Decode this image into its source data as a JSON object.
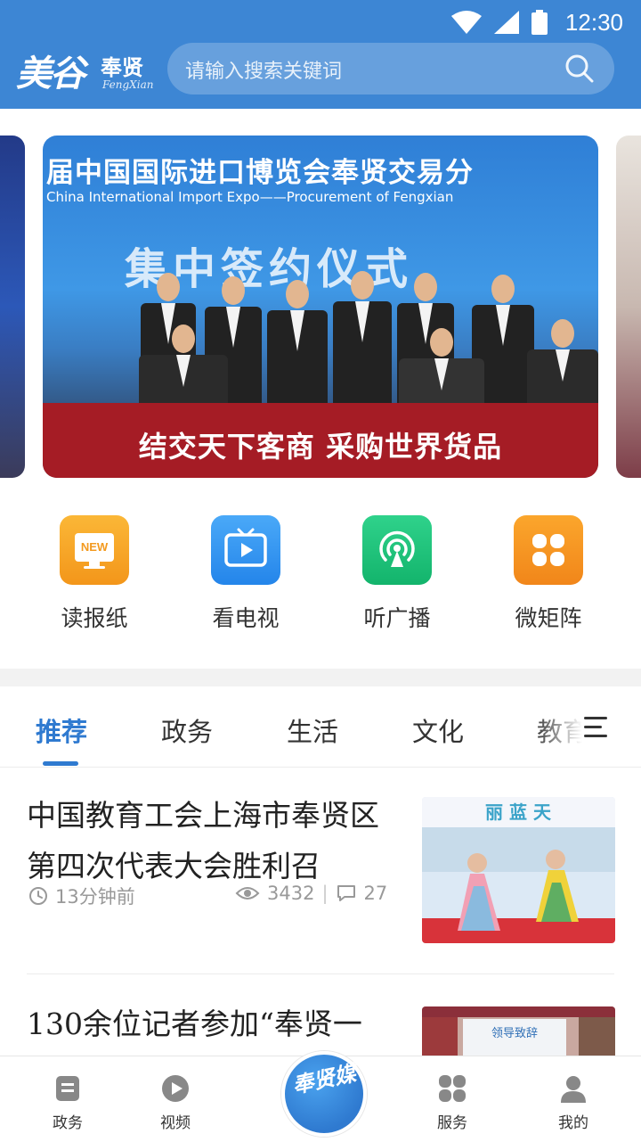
{
  "status_bar": {
    "time": "12:30"
  },
  "header": {
    "logo_calligraphy": "美谷",
    "logo_cn": "奉贤",
    "logo_en": "FengXian",
    "search_placeholder": "请输入搜索关键词"
  },
  "banner": {
    "headline": "届中国国际进口博览会奉贤交易分",
    "headline_en": "China International Import Expo——Procurement of Fengxian",
    "ceremony_text": "集中签约仪式",
    "caption": "结交天下客商 采购世界货品"
  },
  "quick_links": [
    {
      "label": "读报纸",
      "icon": "newspaper-icon",
      "badge": "NEW",
      "color": "#f7a21b"
    },
    {
      "label": "看电视",
      "icon": "tv-icon",
      "color": "#2f8ff0"
    },
    {
      "label": "听广播",
      "icon": "broadcast-icon",
      "color": "#19c27a"
    },
    {
      "label": "微矩阵",
      "icon": "matrix-icon",
      "color": "#f5901e"
    }
  ],
  "tabs": [
    {
      "label": "推荐",
      "active": true
    },
    {
      "label": "政务"
    },
    {
      "label": "生活"
    },
    {
      "label": "文化"
    },
    {
      "label": "教育"
    }
  ],
  "news": [
    {
      "title": "中国教育工会上海市奉贤区第四次代表大会胜利召",
      "time": "13分钟前",
      "views": "3432",
      "comments": "27",
      "thumb_text": "丽 蓝 天"
    },
    {
      "title": "130余位记者参加“奉贤一",
      "thumb_text": "领导致辞"
    }
  ],
  "bottom_nav": [
    {
      "label": "政务",
      "icon": "document-icon"
    },
    {
      "label": "视频",
      "icon": "play-icon"
    },
    {
      "label": "服务",
      "icon": "grid-icon"
    },
    {
      "label": "我的",
      "icon": "user-icon"
    }
  ],
  "bottom_center": {
    "text": "奉贤媒"
  },
  "colors": {
    "header": "#3d86d4",
    "accent": "#2f7ad0",
    "banner_red": "#a51c25"
  }
}
